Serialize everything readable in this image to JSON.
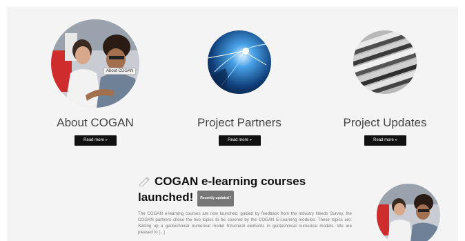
{
  "features": [
    {
      "title": "About COGAN",
      "button": "Read more »",
      "tooltip": "About COGAN",
      "image": "people-meeting-photo"
    },
    {
      "title": "Project Partners",
      "button": "Read more »",
      "image": "globe-network-photo"
    },
    {
      "title": "Project Updates",
      "button": "Read more »",
      "image": "metal-strips-photo"
    }
  ],
  "news": {
    "title_line1": "COGAN e-learning courses",
    "title_line2": "launched!",
    "badge": "Recently updated !",
    "excerpt": "The COGAN e-learning courses are now launched, guided by feedback from the Industry Needs Survey, the COGAN partners chose the two topics to be covered by the COGAN E-Learning modules. These topics are: Setting up a geotechnical numerical model Structural elements in geotechnical numerical models. We are pleased to [...]",
    "thumbnail": "people-meeting-photo"
  }
}
